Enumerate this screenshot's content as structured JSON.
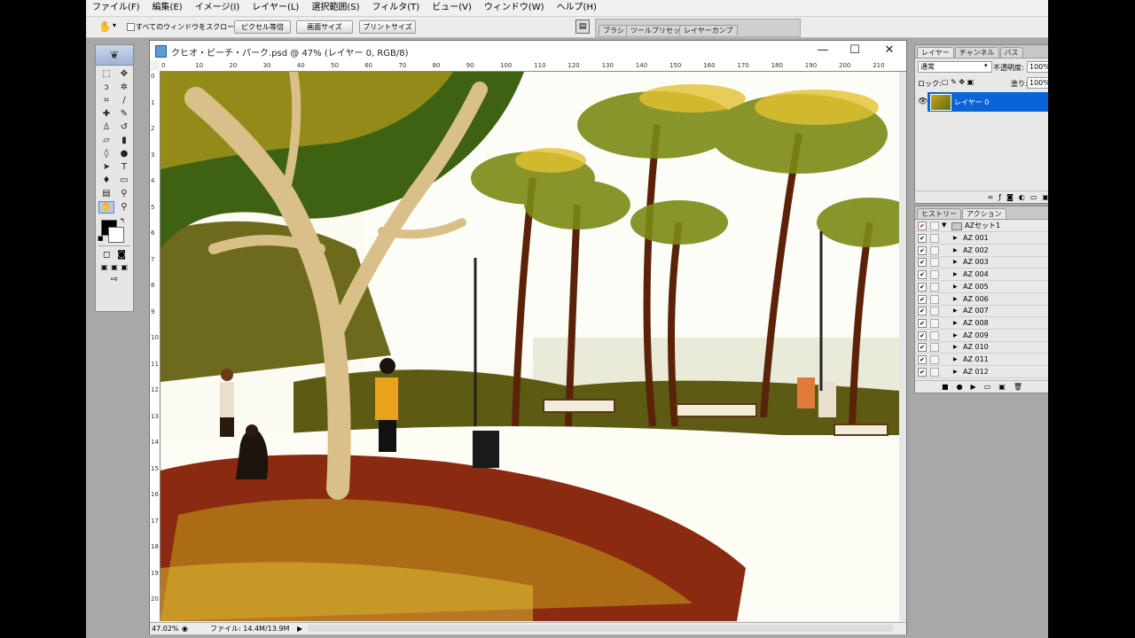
{
  "menu": [
    "ファイル(F)",
    "編集(E)",
    "イメージ(I)",
    "レイヤー(L)",
    "選択範囲(S)",
    "フィルタ(T)",
    "ビュー(V)",
    "ウィンドウ(W)",
    "ヘルプ(H)"
  ],
  "options": {
    "scroll_all_label": "すべてのウィンドウをスクロール",
    "actual_pixels": "ピクセル等倍",
    "fit_screen": "画面サイズ",
    "print_size": "プリントサイズ"
  },
  "palette_well_tabs": [
    "ブラシ",
    "ツールプリセット",
    "レイヤーカンプ"
  ],
  "document": {
    "title": "クヒオ・ビーチ・パーク.psd @ 47% (レイヤー 0, RGB/8)",
    "ruler_top": [
      "0",
      "10",
      "20",
      "30",
      "40",
      "50",
      "60",
      "70",
      "80",
      "90",
      "100",
      "110",
      "120",
      "130",
      "140",
      "150",
      "160",
      "170",
      "180",
      "190",
      "200",
      "210"
    ],
    "ruler_left": [
      "0",
      "1",
      "2",
      "3",
      "4",
      "5",
      "6",
      "7",
      "8",
      "9",
      "10",
      "11",
      "12",
      "13",
      "14",
      "15",
      "16",
      "17",
      "18",
      "19",
      "20"
    ],
    "zoom": "47.02%",
    "file_info": "ファイル: 14.4M/13.9M"
  },
  "layers_panel": {
    "tabs": [
      "レイヤー",
      "チャンネル",
      "パス"
    ],
    "blend_mode": "通常",
    "opacity_label": "不透明度:",
    "opacity_value": "100%",
    "lock_label": "ロック:",
    "fill_label": "塗り:",
    "fill_value": "100%",
    "layer_name": "レイヤー 0"
  },
  "actions_panel": {
    "tabs": [
      "ヒストリー",
      "アクション"
    ],
    "set_name": "AZセット1",
    "items": [
      "AZ 001",
      "AZ 002",
      "AZ 003",
      "AZ 004",
      "AZ 005",
      "AZ 006",
      "AZ 007",
      "AZ 008",
      "AZ 009",
      "AZ 010",
      "AZ 011",
      "AZ 012"
    ]
  },
  "icons": {
    "window_minimize": "—",
    "window_maximize": "☐",
    "window_close": "✕"
  }
}
